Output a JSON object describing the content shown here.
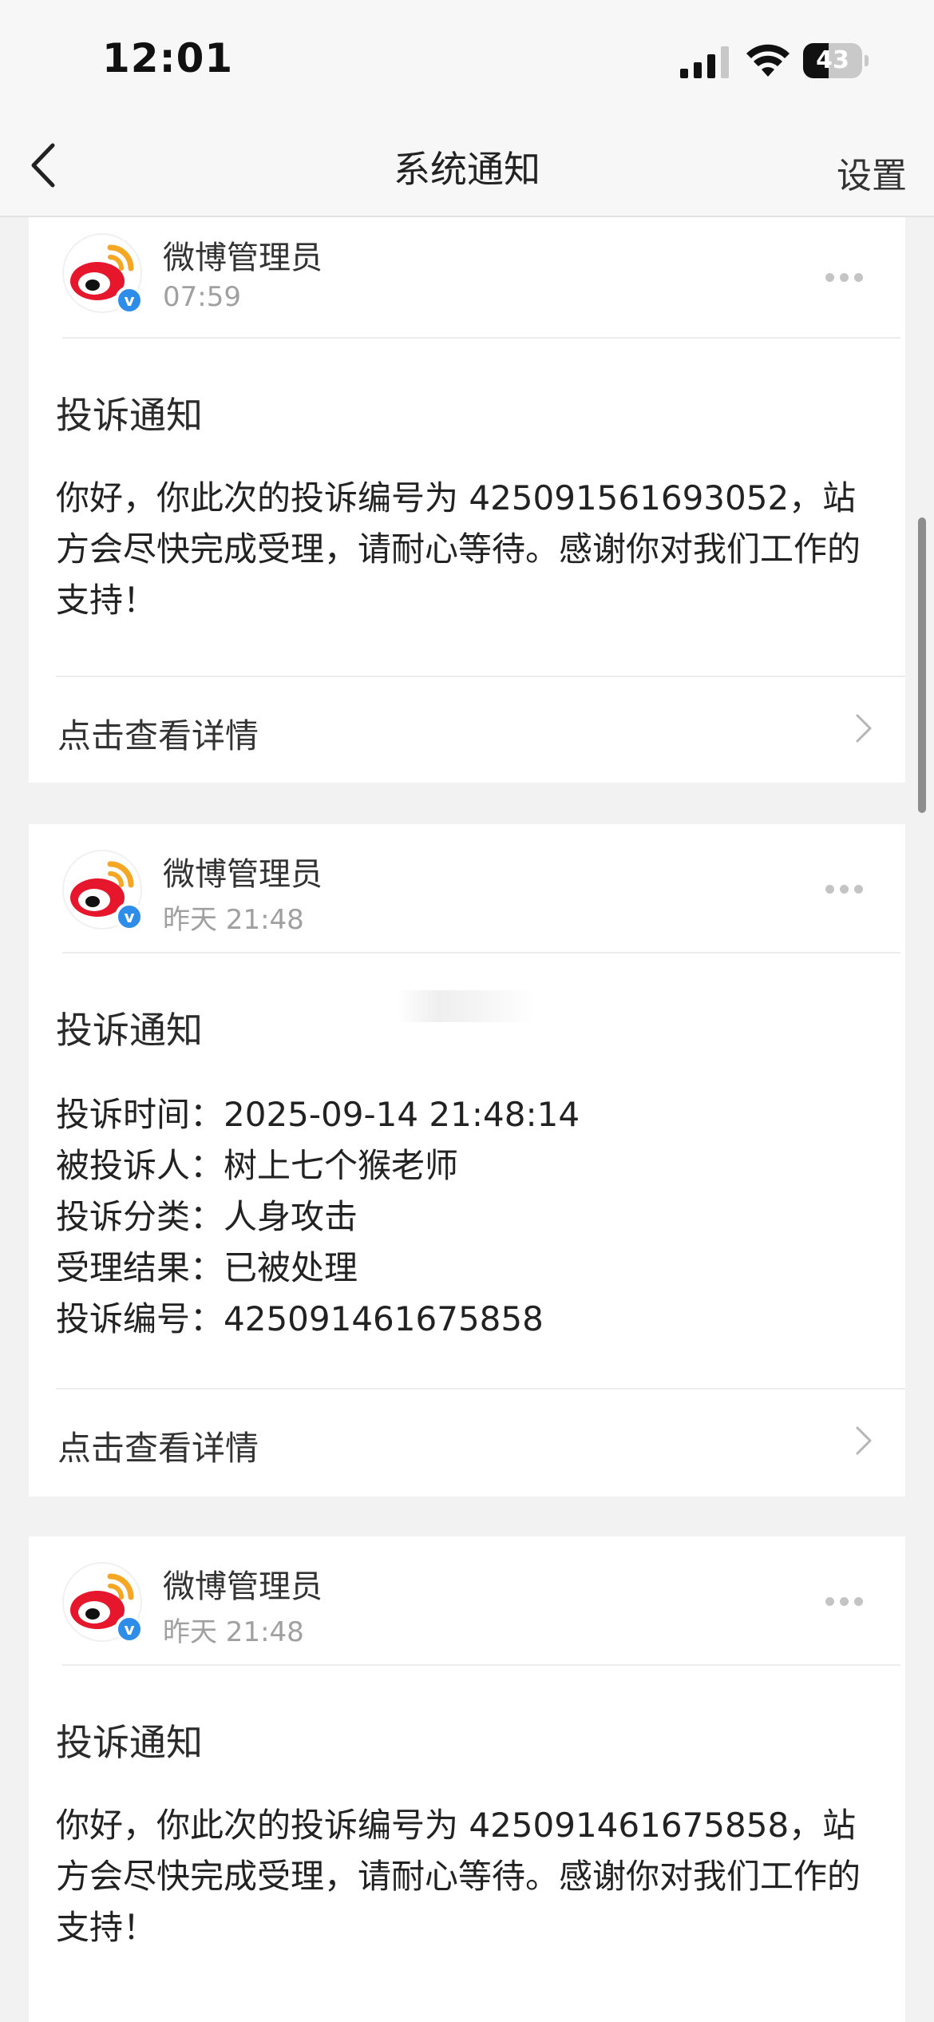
{
  "status_bar": {
    "time": "12:01",
    "battery_level": "43",
    "battery_fraction": 0.43
  },
  "nav": {
    "title": "系统通知",
    "settings_label": "设置"
  },
  "icons": {
    "back": "chevron-left-icon",
    "more": "more-dots-icon",
    "detail": "chevron-right-icon",
    "avatar": "weibo-logo-icon",
    "verified": "verified-badge-icon"
  },
  "colors": {
    "weibo_red": "#e6162d",
    "weibo_orange": "#f5a623",
    "verified_blue": "#2e8de8",
    "page_bg": "#f2f2f2"
  },
  "notifications": [
    {
      "sender": "微博管理员",
      "time": "07:59",
      "title": "投诉通知",
      "body": "你好，你此次的投诉编号为 425091561693052，站方会尽快完成受理，请耐心等待。感谢你对我们工作的支持！",
      "detail_link": "点击查看详情"
    },
    {
      "sender": "微博管理员",
      "time": "昨天 21:48",
      "title": "投诉通知",
      "details": [
        "投诉时间：2025-09-14 21:48:14",
        "被投诉人：树上七个猴老师",
        "投诉分类：人身攻击",
        "受理结果：已被处理",
        "投诉编号：425091461675858"
      ],
      "detail_link": "点击查看详情"
    },
    {
      "sender": "微博管理员",
      "time": "昨天 21:48",
      "title": "投诉通知",
      "body": "你好，你此次的投诉编号为 425091461675858，站方会尽快完成受理，请耐心等待。感谢你对我们工作的支持！"
    }
  ]
}
